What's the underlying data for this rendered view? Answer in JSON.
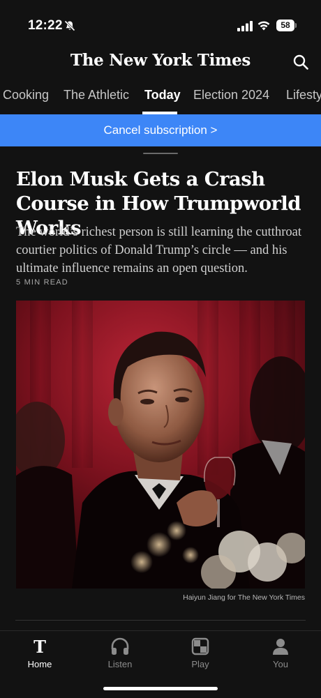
{
  "status_bar": {
    "time": "12:22",
    "battery": "58"
  },
  "masthead": {
    "logo": "The New York Times"
  },
  "section_nav": {
    "tabs": [
      {
        "label": "Cooking"
      },
      {
        "label": "The Athletic"
      },
      {
        "label": "Today"
      },
      {
        "label": "Election 2024"
      },
      {
        "label": "Lifesty"
      }
    ],
    "active_tab": "Today"
  },
  "banner": {
    "label": "Cancel subscription >"
  },
  "article": {
    "headline": "Elon Musk Gets a Crash Course in How Trumpworld Works",
    "summary": "The world’s richest person is still learning the cutthroat courtier politics of Donald Trump’s circle — and his ultimate influence remains an open question.",
    "read_time": "5 MIN READ",
    "photo_credit": "Haiyun Jiang for The New York Times"
  },
  "bottom_nav": {
    "items": [
      {
        "label": "Home",
        "icon": "nyt-t-icon"
      },
      {
        "label": "Listen",
        "icon": "headphones-icon"
      },
      {
        "label": "Play",
        "icon": "puzzle-icon"
      },
      {
        "label": "You",
        "icon": "person-icon"
      }
    ]
  },
  "colors": {
    "background": "#121212",
    "banner": "#3d86f7",
    "text": "#ffffff",
    "muted": "#8c8c8c"
  }
}
